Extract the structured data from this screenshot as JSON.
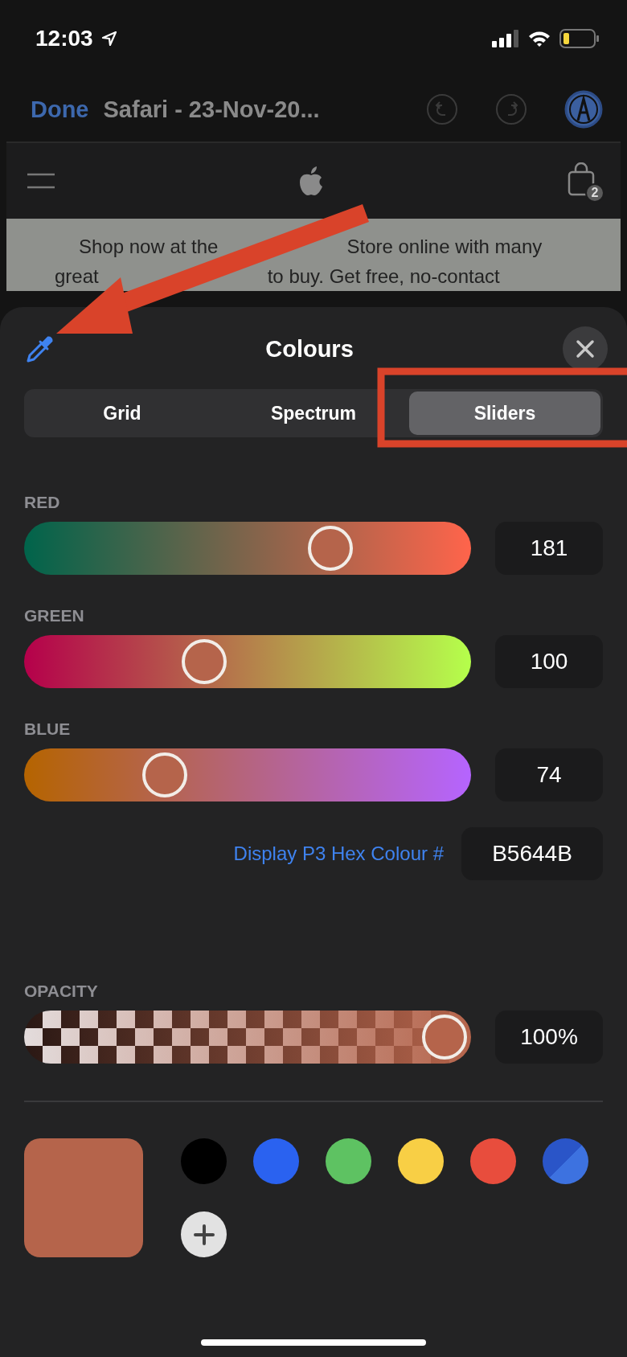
{
  "status_bar": {
    "time": "12:03"
  },
  "toolbar": {
    "done": "Done",
    "title": "Safari - 23-Nov-20..."
  },
  "web_page": {
    "cart_count": "2",
    "banner_lines": [
      [
        "Shop now at the",
        "Store online with many"
      ],
      [
        "great",
        "to buy. Get free, no-contact"
      ]
    ]
  },
  "sheet": {
    "title": "Colours",
    "tabs": [
      {
        "label": "Grid",
        "selected": false
      },
      {
        "label": "Spectrum",
        "selected": false
      },
      {
        "label": "Sliders",
        "selected": true
      }
    ],
    "sliders": [
      {
        "kind": "red",
        "label": "RED",
        "value": "181",
        "level": 0.71
      },
      {
        "kind": "green",
        "label": "GREEN",
        "value": "100",
        "level": 0.39
      },
      {
        "kind": "blue",
        "label": "BLUE",
        "value": "74",
        "level": 0.29
      }
    ],
    "hex": {
      "label": "Display P3 Hex Colour #",
      "value": "B5644B"
    },
    "opacity": {
      "label": "OPACITY",
      "value": "100%",
      "level": 1
    },
    "swatches": [
      {
        "kind": "solid",
        "color": "#000000"
      },
      {
        "kind": "solid",
        "color": "#2a62f0"
      },
      {
        "kind": "solid",
        "color": "#5ec262"
      },
      {
        "kind": "solid",
        "color": "#f8cf45"
      },
      {
        "kind": "solid",
        "color": "#e84d3d"
      },
      {
        "kind": "split",
        "color": "#2a55c8"
      }
    ]
  }
}
